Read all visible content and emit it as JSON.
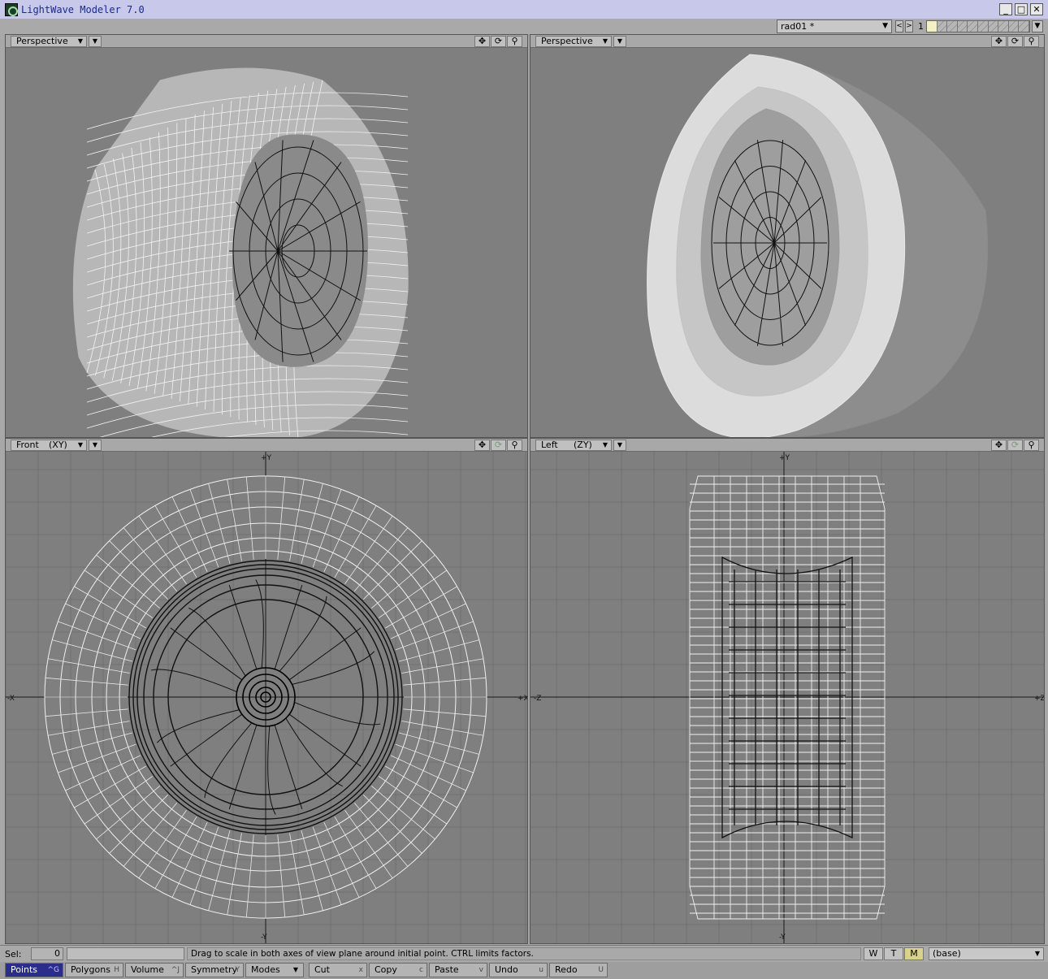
{
  "window": {
    "title": "LightWave Modeler 7.0",
    "minimize": "_",
    "maximize": "□",
    "close": "✕"
  },
  "toolbar": {
    "layer_name": "rad01 *",
    "prev": "<",
    "next": ">",
    "layer_number": "1"
  },
  "viewports": [
    {
      "view": "Perspective",
      "axis": "",
      "shading": "wireframe"
    },
    {
      "view": "Perspective",
      "axis": "",
      "shading": "smooth"
    },
    {
      "view": "Front",
      "axis": "(XY)",
      "shading": "wireframe",
      "axis_labels": [
        "+Y",
        "-Y",
        "-X",
        "+X"
      ]
    },
    {
      "view": "Left",
      "axis": "(ZY)",
      "shading": "wireframe",
      "axis_labels": [
        "+Y",
        "-Y",
        "-Z",
        "+Z"
      ]
    }
  ],
  "status": {
    "sel_label": "Sel:",
    "sel_count": "0",
    "hint": "Drag to scale in both axes of view plane around initial point. CTRL limits factors.",
    "w": "W",
    "t": "T",
    "m": "M",
    "layer": "(base)"
  },
  "buttons": [
    {
      "label": "Points",
      "shortcut": "^G",
      "active": true
    },
    {
      "label": "Polygons",
      "shortcut": "H"
    },
    {
      "label": "Volume",
      "shortcut": "^J"
    },
    {
      "label": "Symmetry",
      "shortcut": "Y"
    },
    {
      "label": "Modes",
      "shortcut": ""
    },
    {
      "label": "Cut",
      "shortcut": "x"
    },
    {
      "label": "Copy",
      "shortcut": "c"
    },
    {
      "label": "Paste",
      "shortcut": "v"
    },
    {
      "label": "Undo",
      "shortcut": "u"
    },
    {
      "label": "Redo",
      "shortcut": "U"
    }
  ],
  "colors": {
    "titlebar": "#c7c8ea",
    "viewport_bg": "#7f7f7f",
    "active_button": "#2b2d8a",
    "selected_layer": "#f4f0c4"
  }
}
